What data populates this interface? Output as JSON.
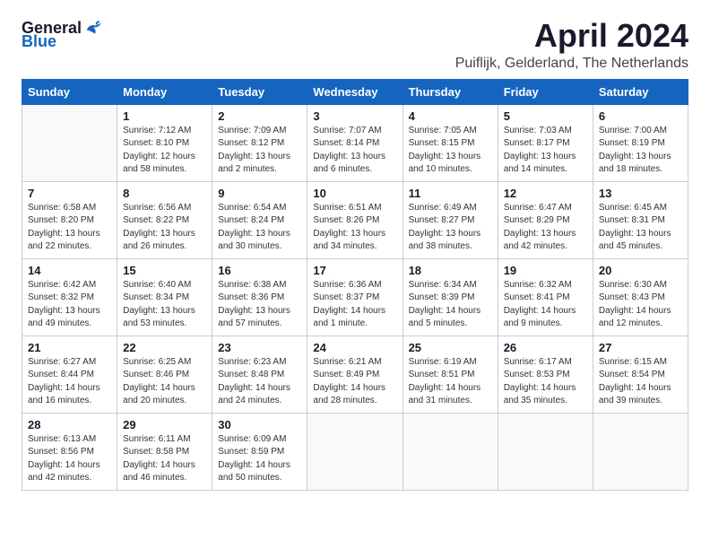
{
  "header": {
    "logo_general": "General",
    "logo_blue": "Blue",
    "month_title": "April 2024",
    "location": "Puiflijk, Gelderland, The Netherlands"
  },
  "days_of_week": [
    "Sunday",
    "Monday",
    "Tuesday",
    "Wednesday",
    "Thursday",
    "Friday",
    "Saturday"
  ],
  "weeks": [
    [
      {
        "day": "",
        "info": ""
      },
      {
        "day": "1",
        "info": "Sunrise: 7:12 AM\nSunset: 8:10 PM\nDaylight: 12 hours\nand 58 minutes."
      },
      {
        "day": "2",
        "info": "Sunrise: 7:09 AM\nSunset: 8:12 PM\nDaylight: 13 hours\nand 2 minutes."
      },
      {
        "day": "3",
        "info": "Sunrise: 7:07 AM\nSunset: 8:14 PM\nDaylight: 13 hours\nand 6 minutes."
      },
      {
        "day": "4",
        "info": "Sunrise: 7:05 AM\nSunset: 8:15 PM\nDaylight: 13 hours\nand 10 minutes."
      },
      {
        "day": "5",
        "info": "Sunrise: 7:03 AM\nSunset: 8:17 PM\nDaylight: 13 hours\nand 14 minutes."
      },
      {
        "day": "6",
        "info": "Sunrise: 7:00 AM\nSunset: 8:19 PM\nDaylight: 13 hours\nand 18 minutes."
      }
    ],
    [
      {
        "day": "7",
        "info": "Sunrise: 6:58 AM\nSunset: 8:20 PM\nDaylight: 13 hours\nand 22 minutes."
      },
      {
        "day": "8",
        "info": "Sunrise: 6:56 AM\nSunset: 8:22 PM\nDaylight: 13 hours\nand 26 minutes."
      },
      {
        "day": "9",
        "info": "Sunrise: 6:54 AM\nSunset: 8:24 PM\nDaylight: 13 hours\nand 30 minutes."
      },
      {
        "day": "10",
        "info": "Sunrise: 6:51 AM\nSunset: 8:26 PM\nDaylight: 13 hours\nand 34 minutes."
      },
      {
        "day": "11",
        "info": "Sunrise: 6:49 AM\nSunset: 8:27 PM\nDaylight: 13 hours\nand 38 minutes."
      },
      {
        "day": "12",
        "info": "Sunrise: 6:47 AM\nSunset: 8:29 PM\nDaylight: 13 hours\nand 42 minutes."
      },
      {
        "day": "13",
        "info": "Sunrise: 6:45 AM\nSunset: 8:31 PM\nDaylight: 13 hours\nand 45 minutes."
      }
    ],
    [
      {
        "day": "14",
        "info": "Sunrise: 6:42 AM\nSunset: 8:32 PM\nDaylight: 13 hours\nand 49 minutes."
      },
      {
        "day": "15",
        "info": "Sunrise: 6:40 AM\nSunset: 8:34 PM\nDaylight: 13 hours\nand 53 minutes."
      },
      {
        "day": "16",
        "info": "Sunrise: 6:38 AM\nSunset: 8:36 PM\nDaylight: 13 hours\nand 57 minutes."
      },
      {
        "day": "17",
        "info": "Sunrise: 6:36 AM\nSunset: 8:37 PM\nDaylight: 14 hours\nand 1 minute."
      },
      {
        "day": "18",
        "info": "Sunrise: 6:34 AM\nSunset: 8:39 PM\nDaylight: 14 hours\nand 5 minutes."
      },
      {
        "day": "19",
        "info": "Sunrise: 6:32 AM\nSunset: 8:41 PM\nDaylight: 14 hours\nand 9 minutes."
      },
      {
        "day": "20",
        "info": "Sunrise: 6:30 AM\nSunset: 8:43 PM\nDaylight: 14 hours\nand 12 minutes."
      }
    ],
    [
      {
        "day": "21",
        "info": "Sunrise: 6:27 AM\nSunset: 8:44 PM\nDaylight: 14 hours\nand 16 minutes."
      },
      {
        "day": "22",
        "info": "Sunrise: 6:25 AM\nSunset: 8:46 PM\nDaylight: 14 hours\nand 20 minutes."
      },
      {
        "day": "23",
        "info": "Sunrise: 6:23 AM\nSunset: 8:48 PM\nDaylight: 14 hours\nand 24 minutes."
      },
      {
        "day": "24",
        "info": "Sunrise: 6:21 AM\nSunset: 8:49 PM\nDaylight: 14 hours\nand 28 minutes."
      },
      {
        "day": "25",
        "info": "Sunrise: 6:19 AM\nSunset: 8:51 PM\nDaylight: 14 hours\nand 31 minutes."
      },
      {
        "day": "26",
        "info": "Sunrise: 6:17 AM\nSunset: 8:53 PM\nDaylight: 14 hours\nand 35 minutes."
      },
      {
        "day": "27",
        "info": "Sunrise: 6:15 AM\nSunset: 8:54 PM\nDaylight: 14 hours\nand 39 minutes."
      }
    ],
    [
      {
        "day": "28",
        "info": "Sunrise: 6:13 AM\nSunset: 8:56 PM\nDaylight: 14 hours\nand 42 minutes."
      },
      {
        "day": "29",
        "info": "Sunrise: 6:11 AM\nSunset: 8:58 PM\nDaylight: 14 hours\nand 46 minutes."
      },
      {
        "day": "30",
        "info": "Sunrise: 6:09 AM\nSunset: 8:59 PM\nDaylight: 14 hours\nand 50 minutes."
      },
      {
        "day": "",
        "info": ""
      },
      {
        "day": "",
        "info": ""
      },
      {
        "day": "",
        "info": ""
      },
      {
        "day": "",
        "info": ""
      }
    ]
  ]
}
